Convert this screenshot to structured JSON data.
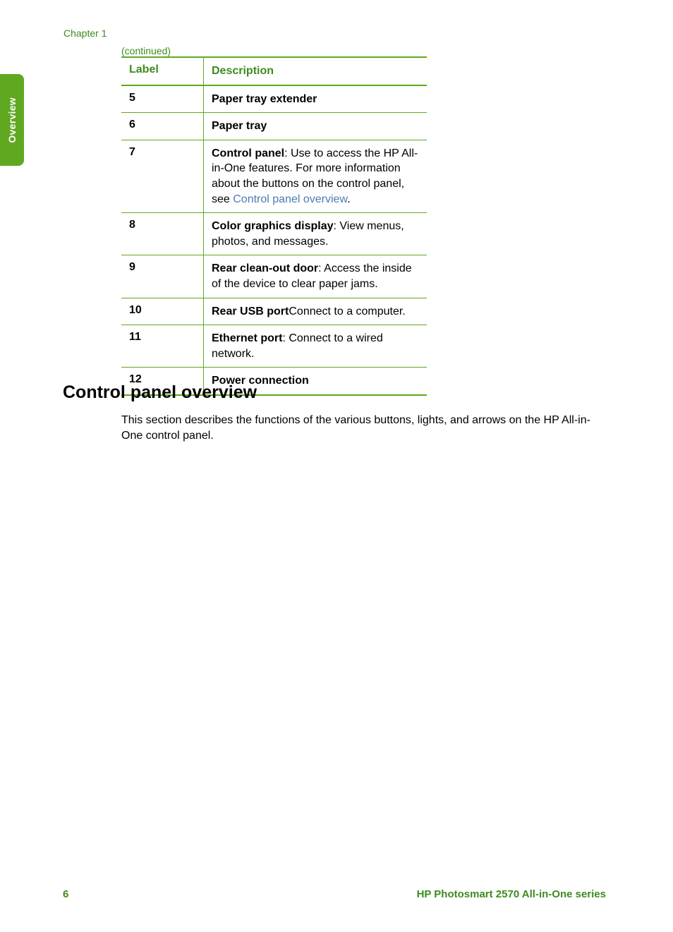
{
  "side_tab": "Overview",
  "chapter": "Chapter 1",
  "continued": "(continued)",
  "table": {
    "header": {
      "label": "Label",
      "description": "Description"
    },
    "rows": [
      {
        "label": "5",
        "bold": "Paper tray extender",
        "rest": "",
        "link": ""
      },
      {
        "label": "6",
        "bold": "Paper tray",
        "rest": "",
        "link": ""
      },
      {
        "label": "7",
        "bold": "Control panel",
        "rest": ": Use to access the HP All-in-One features. For more information about the buttons on the control panel, see ",
        "link": "Control panel overview",
        "after_link": "."
      },
      {
        "label": "8",
        "bold": "Color graphics display",
        "rest": ": View menus, photos, and messages.",
        "link": ""
      },
      {
        "label": "9",
        "bold": "Rear clean-out door",
        "rest": ": Access the inside of the device to clear paper jams.",
        "link": ""
      },
      {
        "label": "10",
        "bold": "Rear USB port",
        "rest": "Connect to a computer.",
        "link": ""
      },
      {
        "label": "11",
        "bold": "Ethernet port",
        "rest": ": Connect to a wired network.",
        "link": ""
      },
      {
        "label": "12",
        "bold": "Power connection",
        "rest": "",
        "link": ""
      }
    ]
  },
  "section": {
    "heading": "Control panel overview",
    "paragraph": "This section describes the functions of the various buttons, lights, and arrows on the HP All-in-One control panel."
  },
  "footer": {
    "page": "6",
    "title": "HP Photosmart 2570 All-in-One series"
  }
}
